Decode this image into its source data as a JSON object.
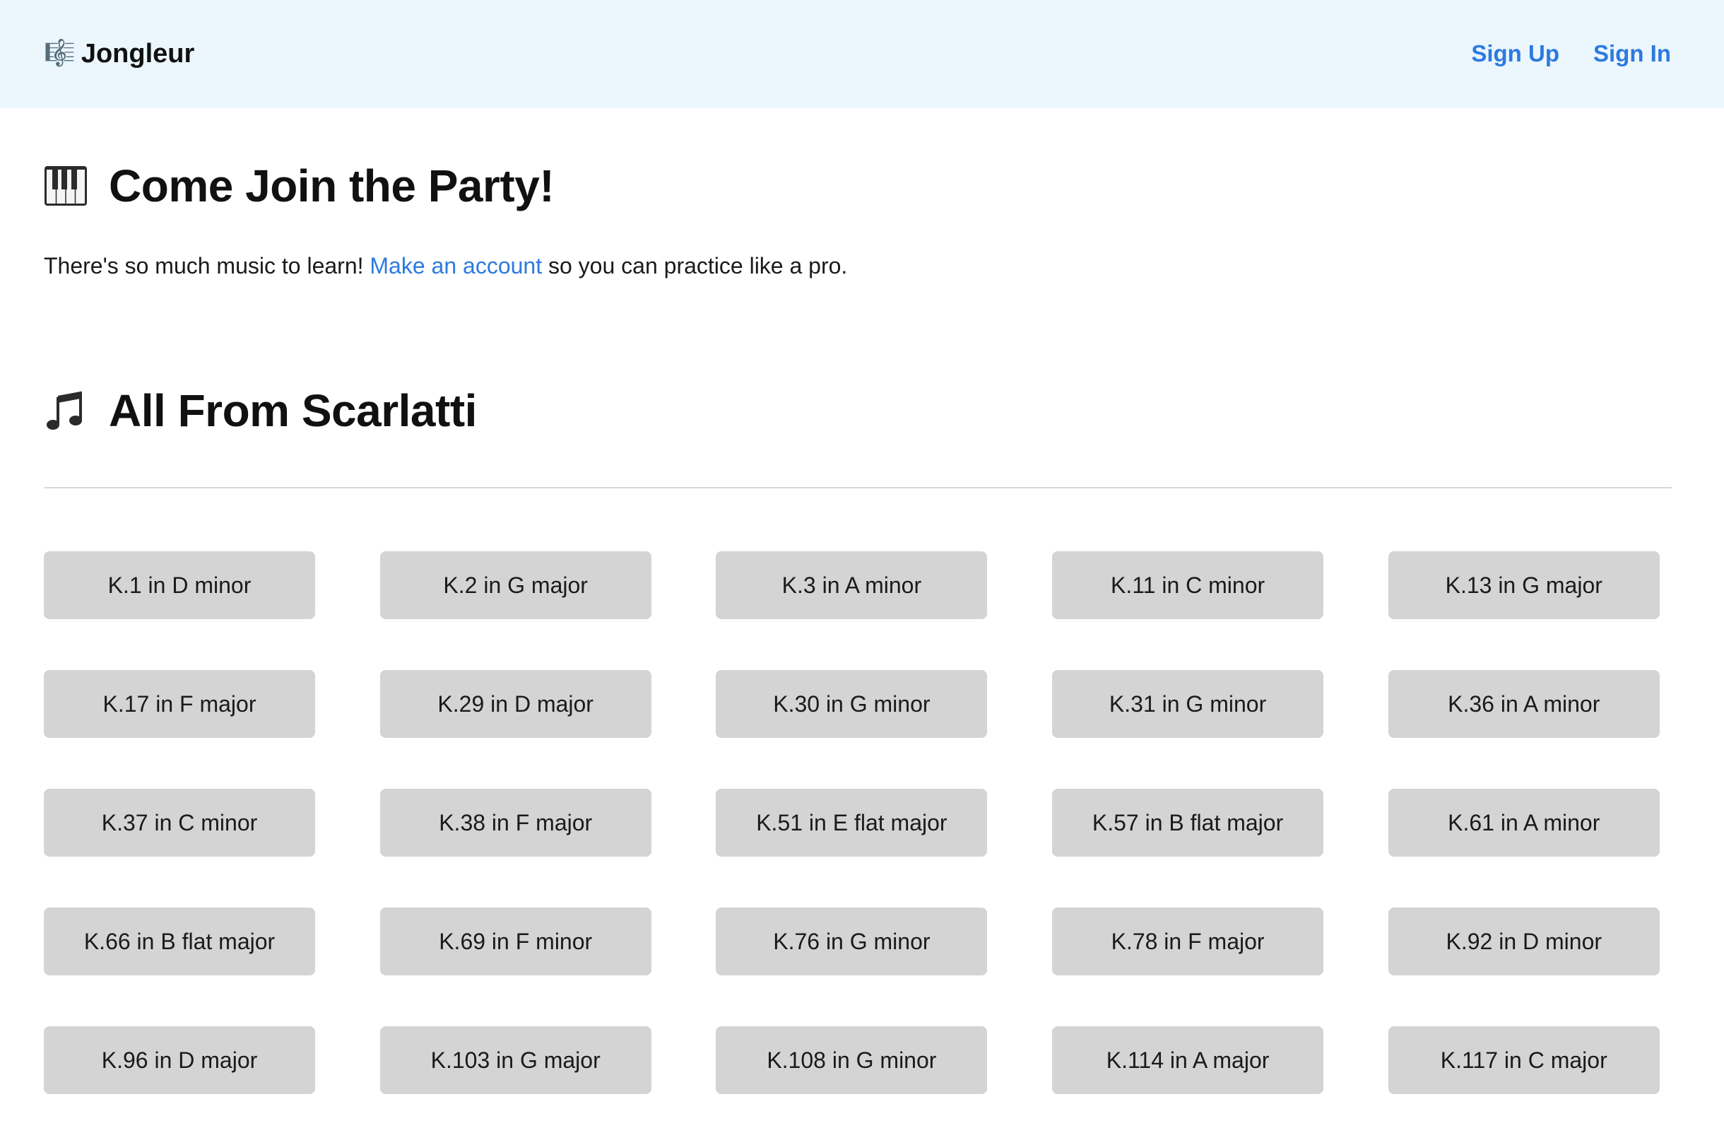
{
  "header": {
    "brand_icon": "🎼",
    "brand_name": "Jongleur",
    "nav": {
      "sign_up": "Sign Up",
      "sign_in": "Sign In"
    }
  },
  "join": {
    "icon": "piano-keyboard-icon",
    "title": "Come Join the Party!",
    "text_before": "There's so much music to learn! ",
    "link_text": "Make an account",
    "text_after": " so you can practice like a pro."
  },
  "scarlatti": {
    "icon": "musical-note-icon",
    "title": "All From Scarlatti",
    "pieces": [
      "K.1 in D minor",
      "K.2 in G major",
      "K.3 in A minor",
      "K.11 in C minor",
      "K.13 in G major",
      "K.17 in F major",
      "K.29 in D major",
      "K.30 in G minor",
      "K.31 in G minor",
      "K.36 in A minor",
      "K.37 in C minor",
      "K.38 in F major",
      "K.51 in E flat major",
      "K.57 in B flat major",
      "K.61 in A minor",
      "K.66 in B flat major",
      "K.69 in F minor",
      "K.76 in G minor",
      "K.78 in F major",
      "K.92 in D minor",
      "K.96 in D major",
      "K.103 in G major",
      "K.108 in G minor",
      "K.114 in A major",
      "K.117 in C major"
    ]
  },
  "colors": {
    "header_bg": "#ebf6fd",
    "link": "#2c7ae0",
    "button_bg": "#d4d4d4",
    "divider": "#d9d9d9"
  }
}
